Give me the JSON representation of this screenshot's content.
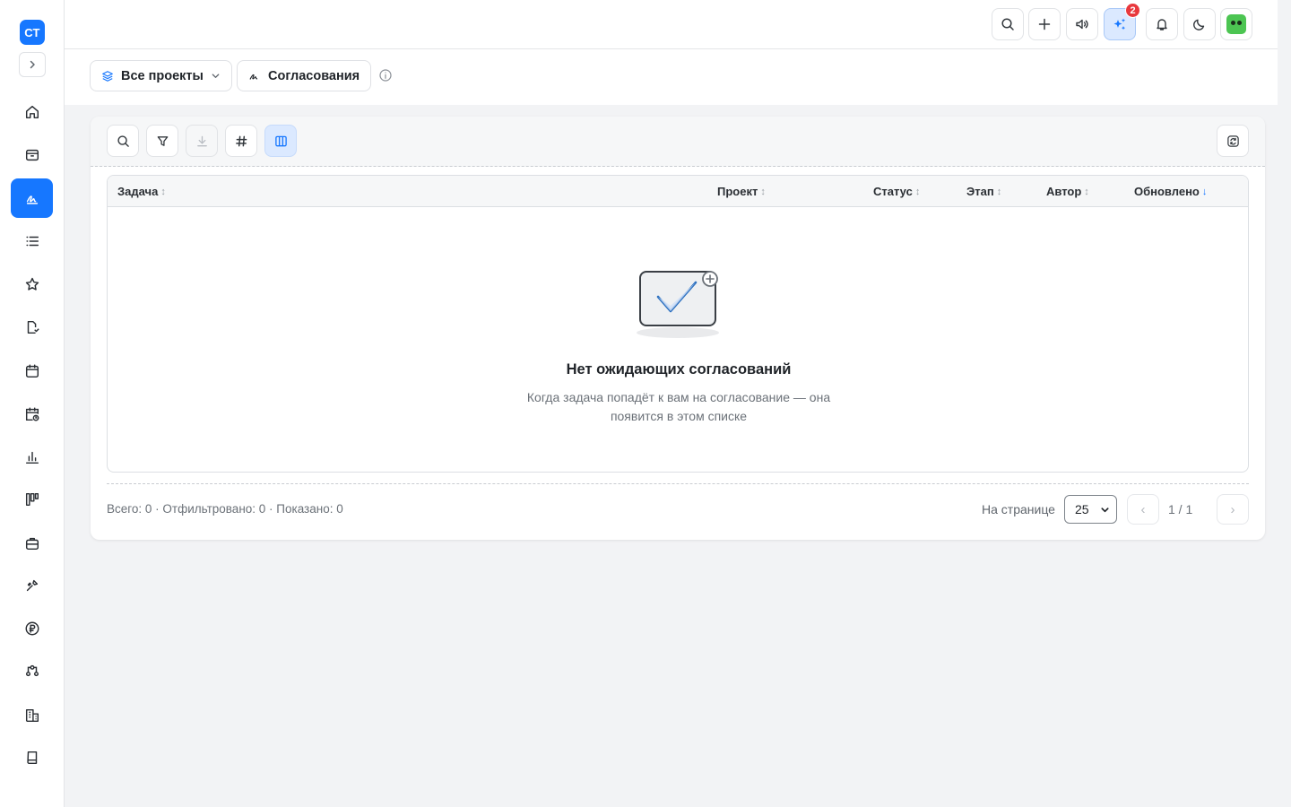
{
  "app": {
    "logo_text": "СТ"
  },
  "sidebar": {
    "items": [
      {
        "name": "home",
        "icon": "home-icon"
      },
      {
        "name": "inbox",
        "icon": "inbox-icon"
      },
      {
        "name": "approvals",
        "icon": "signature-icon",
        "active": true
      },
      {
        "name": "list",
        "icon": "list-icon"
      },
      {
        "name": "favorites",
        "icon": "star-icon"
      },
      {
        "name": "documents",
        "icon": "document-icon"
      },
      {
        "name": "calendar",
        "icon": "calendar-icon"
      },
      {
        "name": "schedule",
        "icon": "calendar-clock-icon"
      },
      {
        "name": "reports",
        "icon": "bar-chart-icon"
      },
      {
        "name": "kanban",
        "icon": "kanban-icon"
      },
      {
        "name": "portfolio",
        "icon": "briefcase-icon"
      },
      {
        "name": "tools",
        "icon": "tools-icon"
      },
      {
        "name": "finance",
        "icon": "ruble-icon"
      },
      {
        "name": "workflows",
        "icon": "nodes-icon"
      },
      {
        "name": "companies",
        "icon": "building-icon"
      },
      {
        "name": "knowledge-base",
        "icon": "book-icon"
      }
    ]
  },
  "topbar": {
    "ai_badge_count": "2"
  },
  "subbar": {
    "projects_label": "Все проекты",
    "section_label": "Согласования"
  },
  "table": {
    "columns": [
      {
        "label": "Задача",
        "sort": "↕"
      },
      {
        "label": "Проект",
        "sort": "↕"
      },
      {
        "label": "Статус",
        "sort": "↕"
      },
      {
        "label": "Этап",
        "sort": "↕"
      },
      {
        "label": "Автор",
        "sort": "↕"
      },
      {
        "label": "Обновлено",
        "sort": "↓"
      }
    ],
    "rows": [],
    "empty_title": "Нет ожидающих согласований",
    "empty_description": "Когда задача попадёт к вам на согласование — она появится в этом списке"
  },
  "footer": {
    "stats": "Всего: 0 · Отфильтровано: 0 · Показано: 0",
    "per_page_label": "На странице",
    "per_page_value": "25",
    "prev_label": "‹",
    "next_label": "›",
    "page_indicator": "1 / 1"
  },
  "colors": {
    "accent": "#1677ff",
    "badge": "#e8383d",
    "background": "#f2f3f5"
  }
}
